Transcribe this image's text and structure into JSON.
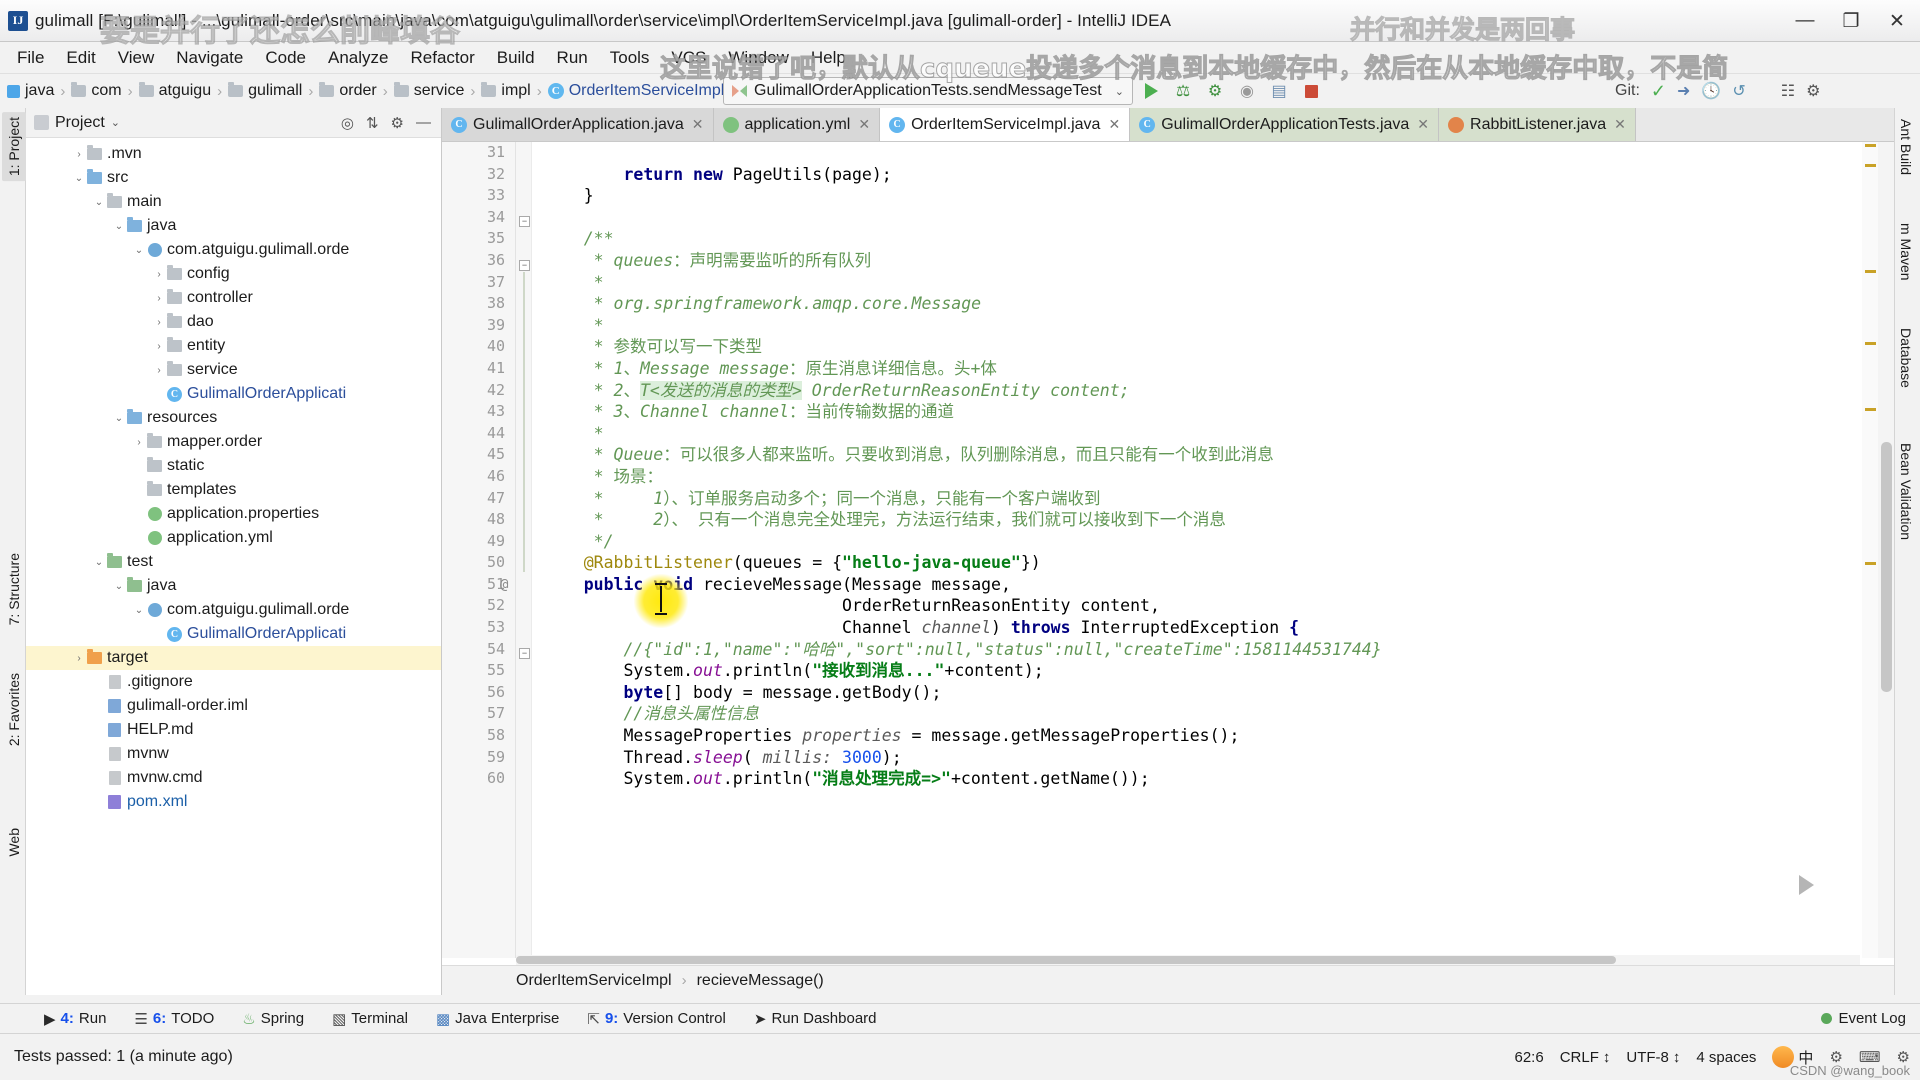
{
  "window": {
    "title": "gulimall [F:\\gulimall] - ...\\gulimall-order\\src\\main\\java\\com\\atguigu\\gulimall\\order\\service\\impl\\OrderItemServiceImpl.java [gulimall-order] - IntelliJ IDEA",
    "app_icon_letter": "IJ",
    "minimize": "—",
    "maximize": "❐",
    "close": "✕"
  },
  "watermarks": {
    "top_left": "要是并行了还怎么削峰填谷",
    "top_right": "并行和并发是两回事",
    "second_line": "这里说错了吧，默认从cqueue投递多个消息到本地缓存中，然后在从本地缓存中取，不是简",
    "credit": "CSDN @wang_book"
  },
  "menubar": {
    "items": [
      "File",
      "Edit",
      "View",
      "Navigate",
      "Code",
      "Analyze",
      "Refactor",
      "Build",
      "Run",
      "Tools",
      "VCS",
      "Window",
      "Help"
    ]
  },
  "navbar": {
    "crumbs": [
      {
        "label": "java",
        "icon": "blue-square-icon"
      },
      {
        "label": "com",
        "icon": "folder-icon"
      },
      {
        "label": "atguigu",
        "icon": "folder-icon"
      },
      {
        "label": "gulimall",
        "icon": "folder-icon"
      },
      {
        "label": "order",
        "icon": "folder-icon"
      },
      {
        "label": "service",
        "icon": "folder-icon"
      },
      {
        "label": "impl",
        "icon": "folder-icon"
      },
      {
        "label": "OrderItemServiceImpl",
        "icon": "java-class-icon"
      }
    ],
    "separator": "›",
    "run_config": "GulimallOrderApplicationTests.sendMessageTest",
    "run_config_chevron": "⌄",
    "git_label": "Git:",
    "toolbar_icons": [
      "run-icon",
      "debug-icon",
      "run-with-coverage-icon",
      "profile-icon",
      "attach-icon",
      "stop-icon"
    ],
    "git_icons": [
      "update-project-icon",
      "commit-icon",
      "history-icon",
      "rollback-icon"
    ]
  },
  "left_strip": {
    "tabs": [
      {
        "label": "1: Project",
        "selected": true
      },
      {
        "label": "7: Structure",
        "selected": false
      },
      {
        "label": "2: Favorites",
        "selected": false
      },
      {
        "label": "Web",
        "selected": false
      }
    ]
  },
  "right_strip": {
    "tabs": [
      {
        "label": "Ant Build"
      },
      {
        "label": "m Maven"
      },
      {
        "label": "Database"
      },
      {
        "label": "Bean Validation"
      }
    ]
  },
  "project_panel": {
    "title": "Project",
    "chevron": "⌄",
    "actions": [
      "target-icon",
      "collapse-all-icon",
      "settings-icon",
      "hide-icon"
    ],
    "tree": [
      {
        "indent": 2,
        "arrow": "›",
        "icon": "folder-icon",
        "label": ".mvn",
        "selected": false
      },
      {
        "indent": 2,
        "arrow": "⌄",
        "icon": "folder-src-icon",
        "label": "src",
        "selected": false
      },
      {
        "indent": 3,
        "arrow": "⌄",
        "icon": "folder-icon",
        "label": "main",
        "selected": false
      },
      {
        "indent": 4,
        "arrow": "⌄",
        "icon": "folder-src-icon",
        "label": "java",
        "selected": false
      },
      {
        "indent": 5,
        "arrow": "⌄",
        "icon": "package-icon",
        "label": "com.atguigu.gulimall.orde",
        "selected": false
      },
      {
        "indent": 6,
        "arrow": "›",
        "icon": "folder-icon",
        "label": "config",
        "selected": false
      },
      {
        "indent": 6,
        "arrow": "›",
        "icon": "folder-icon",
        "label": "controller",
        "selected": false
      },
      {
        "indent": 6,
        "arrow": "›",
        "icon": "folder-icon",
        "label": "dao",
        "selected": false
      },
      {
        "indent": 6,
        "arrow": "›",
        "icon": "folder-icon",
        "label": "entity",
        "selected": false
      },
      {
        "indent": 6,
        "arrow": "›",
        "icon": "folder-icon",
        "label": "service",
        "selected": false
      },
      {
        "indent": 6,
        "arrow": "",
        "icon": "java-class-icon",
        "label": "GulimallOrderApplicati",
        "selected": false,
        "blue": true
      },
      {
        "indent": 4,
        "arrow": "⌄",
        "icon": "folder-res-icon",
        "label": "resources",
        "selected": false
      },
      {
        "indent": 5,
        "arrow": "›",
        "icon": "folder-icon",
        "label": "mapper.order",
        "selected": false
      },
      {
        "indent": 5,
        "arrow": "",
        "icon": "folder-icon",
        "label": "static",
        "selected": false
      },
      {
        "indent": 5,
        "arrow": "",
        "icon": "folder-icon",
        "label": "templates",
        "selected": false
      },
      {
        "indent": 5,
        "arrow": "",
        "icon": "properties-file-icon",
        "label": "application.properties",
        "selected": false
      },
      {
        "indent": 5,
        "arrow": "",
        "icon": "yml-file-icon",
        "label": "application.yml",
        "selected": false
      },
      {
        "indent": 3,
        "arrow": "⌄",
        "icon": "folder-test-icon",
        "label": "test",
        "selected": false
      },
      {
        "indent": 4,
        "arrow": "⌄",
        "icon": "folder-test-src-icon",
        "label": "java",
        "selected": false
      },
      {
        "indent": 5,
        "arrow": "⌄",
        "icon": "package-icon",
        "label": "com.atguigu.gulimall.orde",
        "selected": false
      },
      {
        "indent": 6,
        "arrow": "",
        "icon": "java-class-icon",
        "label": "GulimallOrderApplicati",
        "selected": false,
        "blue": true
      },
      {
        "indent": 2,
        "arrow": "›",
        "icon": "folder-target-icon",
        "label": "target",
        "selected": true
      },
      {
        "indent": 3,
        "arrow": "",
        "icon": "gitignore-file-icon",
        "label": ".gitignore",
        "selected": false
      },
      {
        "indent": 3,
        "arrow": "",
        "icon": "iml-file-icon",
        "label": "gulimall-order.iml",
        "selected": false
      },
      {
        "indent": 3,
        "arrow": "",
        "icon": "md-file-icon",
        "label": "HELP.md",
        "selected": false
      },
      {
        "indent": 3,
        "arrow": "",
        "icon": "file-icon",
        "label": "mvnw",
        "selected": false
      },
      {
        "indent": 3,
        "arrow": "",
        "icon": "file-icon",
        "label": "mvnw.cmd",
        "selected": false
      },
      {
        "indent": 3,
        "arrow": "",
        "icon": "maven-file-icon",
        "label": "pom.xml",
        "selected": false,
        "blue2": true
      }
    ]
  },
  "editor": {
    "tabs": [
      {
        "label": "GulimallOrderApplication.java",
        "icon": "java-class-icon",
        "active": false,
        "close": "✕"
      },
      {
        "label": "application.yml",
        "icon": "yml-file-icon",
        "active": false,
        "close": "✕"
      },
      {
        "label": "OrderItemServiceImpl.java",
        "icon": "java-class-icon",
        "active": true,
        "close": "✕"
      },
      {
        "label": "GulimallOrderApplicationTests.java",
        "icon": "java-class-icon",
        "active": false,
        "close": "✕"
      },
      {
        "label": "RabbitListener.java",
        "icon": "rabbit-file-icon",
        "active": false,
        "close": "✕"
      }
    ],
    "first_line_number": 31,
    "lines": [
      {
        "n": 31,
        "html": ""
      },
      {
        "n": 32,
        "html": "        <span class=\"kw\">return</span> <span class=\"kw\">new</span> PageUtils(page);"
      },
      {
        "n": 33,
        "html": "    }"
      },
      {
        "n": 34,
        "html": ""
      },
      {
        "n": 35,
        "html": "    <span class=\"cmt\">/**</span>"
      },
      {
        "n": 36,
        "html": "     <span class=\"cmt\">* queues</span><span class=\"cmtn\">：声明需要监听的所有队列</span>"
      },
      {
        "n": 37,
        "html": "     <span class=\"cmt\">*</span>"
      },
      {
        "n": 38,
        "html": "     <span class=\"cmt\">* org.springframework.amqp.core.Message</span>"
      },
      {
        "n": 39,
        "html": "     <span class=\"cmt\">*</span>"
      },
      {
        "n": 40,
        "html": "     <span class=\"cmt\">* </span><span class=\"cmtn\">参数可以写一下类型</span>"
      },
      {
        "n": 41,
        "html": "     <span class=\"cmt\">* 1</span><span class=\"cmtn\">、</span><span class=\"cmt\">Message message</span><span class=\"cmtn\">：原生消息详细信息。头+体</span>"
      },
      {
        "n": 42,
        "html": "     <span class=\"cmt\">* 2</span><span class=\"cmtn\">、</span><span class=\"lhl\">T&lt;发送的消息的类型&gt;</span><span class=\"cmt\"> OrderReturnReasonEntity content;</span>"
      },
      {
        "n": 43,
        "html": "     <span class=\"cmt\">* 3</span><span class=\"cmtn\">、</span><span class=\"cmt\">Channel channel</span><span class=\"cmtn\">：当前传输数据的通道</span>"
      },
      {
        "n": 44,
        "html": "     <span class=\"cmt\">*</span>"
      },
      {
        "n": 45,
        "html": "     <span class=\"cmt\">* Queue</span><span class=\"cmtn\">：可以很多人都来监听。只要收到消息，队列删除消息，而且只能有一个收到此消息</span>"
      },
      {
        "n": 46,
        "html": "     <span class=\"cmt\">* </span><span class=\"cmtn\">场景：</span>"
      },
      {
        "n": 47,
        "html": "     <span class=\"cmt\">*     1</span><span class=\"cmtn\">）、订单服务启动多个；同一个消息，只能有一个客户端收到</span>"
      },
      {
        "n": 48,
        "html": "     <span class=\"cmt\">*     2</span><span class=\"cmtn\">）、 只有一个消息完全处理完，方法运行结束，我们就可以接收到下一个消息</span>"
      },
      {
        "n": 49,
        "html": "     <span class=\"cmt\">*/</span>"
      },
      {
        "n": 50,
        "html": "    <span class=\"ann\">@RabbitListener</span>(queues = {<span class=\"str\">\"hello-java-queue\"</span>})"
      },
      {
        "n": 51,
        "html": "    <span class=\"kw\">public</span> <span class=\"kw\">void</span> recieveMessage(Message message,"
      },
      {
        "n": 52,
        "html": "                              OrderReturnReasonEntity content,"
      },
      {
        "n": 53,
        "html": "                              Channel <span class=\"par\">channel</span>) <span class=\"kw\">throws</span> InterruptedException <span class=\"kw\">{</span>"
      },
      {
        "n": 54,
        "html": "        <span class=\"cmt\">//{\"id\":1,\"name\":\"哈哈\",\"sort\":null,\"status\":null,\"createTime\":1581144531744}</span>"
      },
      {
        "n": 55,
        "html": "        System.<span class=\"fld\">out</span>.println(<span class=\"str\">\"接收到消息...\"</span>+content);"
      },
      {
        "n": 56,
        "html": "        <span class=\"kw\">byte</span>[] body = message.getBody();"
      },
      {
        "n": 57,
        "html": "        <span class=\"cmt\">//消息头属性信息</span>"
      },
      {
        "n": 58,
        "html": "        MessageProperties <span class=\"par\">properties</span> = message.getMessageProperties();"
      },
      {
        "n": 59,
        "html": "        Thread.<span class=\"fld\">sleep</span>( <span class=\"par\">millis:</span> <span class=\"num\">3000</span>);"
      },
      {
        "n": 60,
        "html": "        System.<span class=\"fld\">out</span>.println(<span class=\"str\">\"消息处理完成=&gt;\"</span>+content.getName());"
      }
    ],
    "annotations": [
      {
        "line": 51,
        "text": "@"
      }
    ],
    "breadcrumb": [
      "OrderItemServiceImpl",
      "recieveMessage()"
    ],
    "breadcrumb_separator": "›"
  },
  "bottom_bar": {
    "items": [
      {
        "num": "4:",
        "label": "Run",
        "icon": "play-icon"
      },
      {
        "num": "6:",
        "label": "TODO",
        "icon": "todo-icon"
      },
      {
        "num": "",
        "label": "Spring",
        "icon": "spring-icon"
      },
      {
        "num": "",
        "label": "Terminal",
        "icon": "terminal-icon"
      },
      {
        "num": "",
        "label": "Java Enterprise",
        "icon": "java-ee-icon"
      },
      {
        "num": "9:",
        "label": "Version Control",
        "icon": "vcs-icon"
      },
      {
        "num": "",
        "label": "Run Dashboard",
        "icon": "dashboard-icon"
      }
    ],
    "event_log": "Event Log"
  },
  "statusbar": {
    "message": "Tests passed: 1 (a minute ago)",
    "caret": "62:6",
    "line_sep": "CRLF",
    "encoding": "UTF-8",
    "indent": "4 spaces",
    "ime": "中",
    "line_sep_chevron": "↕",
    "encoding_chevron": "↕"
  }
}
